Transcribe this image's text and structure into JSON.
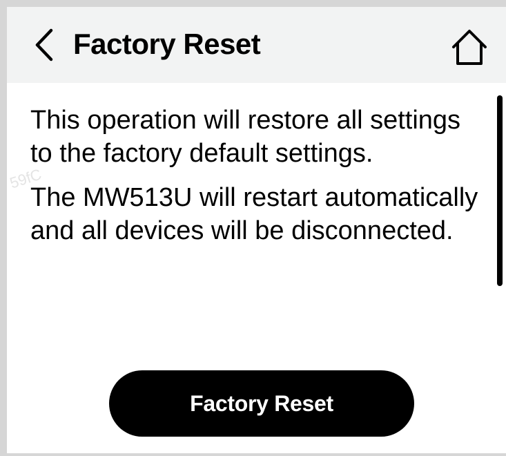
{
  "header": {
    "title": "Factory Reset",
    "back_icon": "chevron-left-icon",
    "home_icon": "home-icon"
  },
  "content": {
    "paragraphs": [
      "This operation will restore all settings to the factory default settings.",
      "The MW513U will restart automatically and all devices will be disconnected."
    ]
  },
  "actions": {
    "reset_label": "Factory Reset"
  },
  "colors": {
    "header_bg": "#f2f3f3",
    "text": "#000000",
    "button_bg": "#000000",
    "button_text": "#ffffff"
  }
}
